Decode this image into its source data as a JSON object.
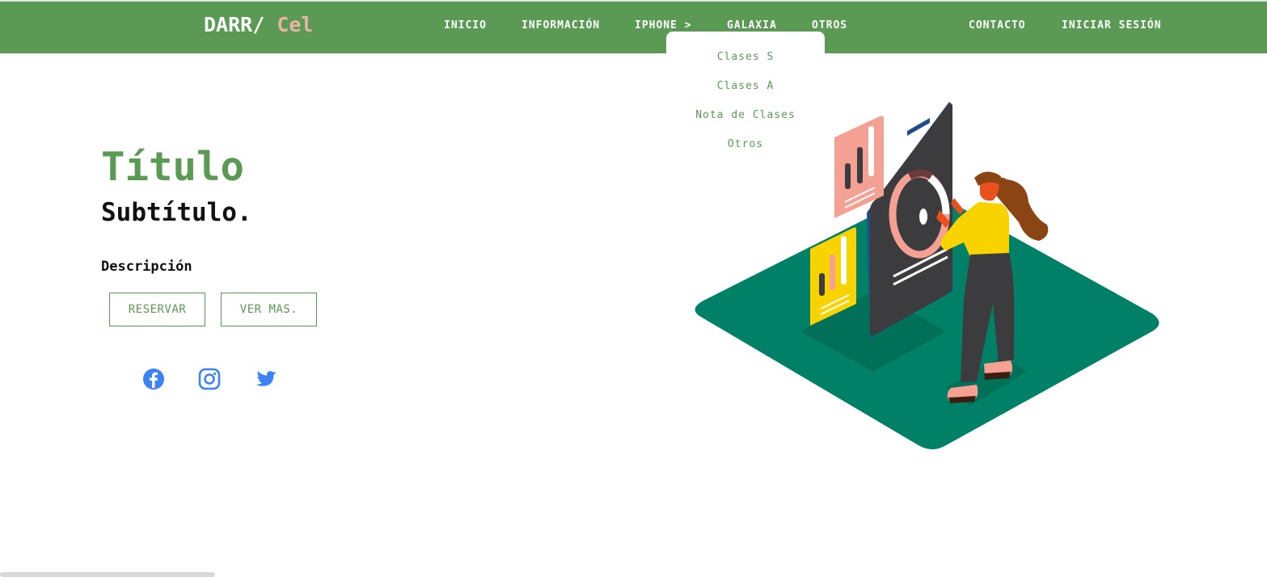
{
  "brand": {
    "main": "DARR/",
    "accent": "Cel"
  },
  "nav": {
    "inicio": "INICIO",
    "informacion": "INFORMACIÓN",
    "iphone": "IPHONE >",
    "galaxia": "GALAXIA",
    "otros": "OTROS",
    "contacto": "CONTACTO",
    "iniciar_sesion": "INICIAR SESIÓN"
  },
  "dropdown": {
    "items": [
      "Clases S",
      "Clases A",
      "Nota de Clases",
      "Otros"
    ]
  },
  "hero": {
    "title": "Título",
    "subtitle": "Subtítulo.",
    "description": "Descripción",
    "reserve_label": "RESERVAR",
    "more_label": "VER MAS."
  },
  "social": {
    "icons": [
      "facebook-icon",
      "instagram-icon",
      "twitter-icon"
    ],
    "color": "#3b82f6"
  },
  "colors": {
    "primary_green": "#5a9a55",
    "brand_accent": "#e9b3a4",
    "platform_teal": "#008066"
  }
}
